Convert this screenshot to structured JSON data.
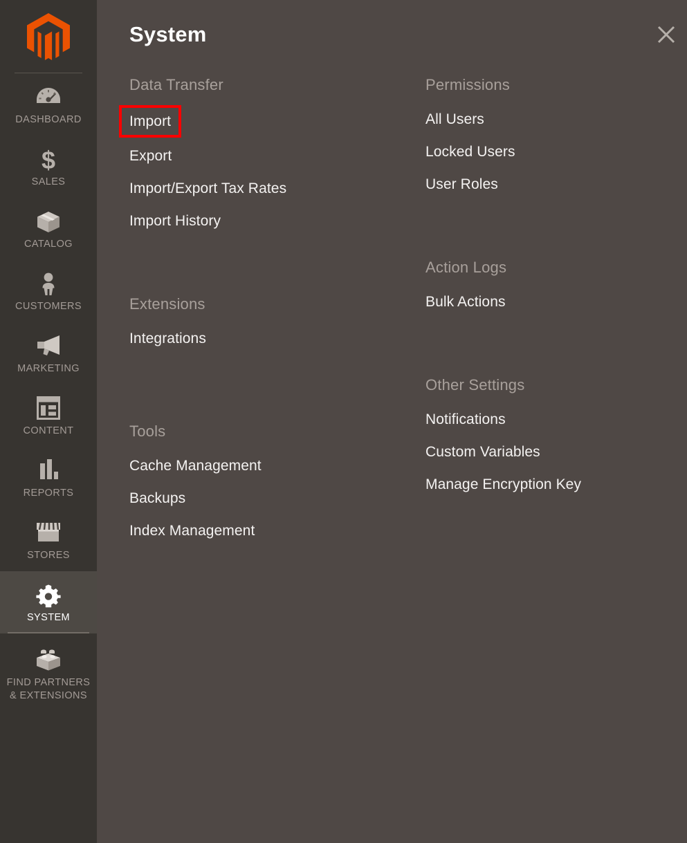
{
  "sidebar": {
    "logo": "magento-logo-icon",
    "items": [
      {
        "label": "DASHBOARD",
        "icon": "gauge-icon",
        "active": false
      },
      {
        "label": "SALES",
        "icon": "dollar-icon",
        "active": false
      },
      {
        "label": "CATALOG",
        "icon": "box-icon",
        "active": false
      },
      {
        "label": "CUSTOMERS",
        "icon": "person-icon",
        "active": false
      },
      {
        "label": "MARKETING",
        "icon": "megaphone-icon",
        "active": false
      },
      {
        "label": "CONTENT",
        "icon": "layout-icon",
        "active": false
      },
      {
        "label": "REPORTS",
        "icon": "bar-chart-icon",
        "active": false
      },
      {
        "label": "STORES",
        "icon": "storefront-icon",
        "active": false
      },
      {
        "label": "SYSTEM",
        "icon": "gear-icon",
        "active": true
      },
      {
        "label": "FIND PARTNERS & EXTENSIONS",
        "label_line1": "FIND PARTNERS",
        "label_line2": "& EXTENSIONS",
        "icon": "brick-icon",
        "active": false
      }
    ]
  },
  "panel": {
    "title": "System",
    "close_label": "close-icon"
  },
  "menu": {
    "left_column": [
      {
        "title": "Data Transfer",
        "links": [
          {
            "label": "Import",
            "highlighted": true
          },
          {
            "label": "Export",
            "highlighted": false
          },
          {
            "label": "Import/Export Tax Rates",
            "highlighted": false
          },
          {
            "label": "Import History",
            "highlighted": false
          }
        ]
      },
      {
        "title": "Extensions",
        "links": [
          {
            "label": "Integrations",
            "highlighted": false
          }
        ]
      },
      {
        "title": "Tools",
        "links": [
          {
            "label": "Cache Management",
            "highlighted": false
          },
          {
            "label": "Backups",
            "highlighted": false
          },
          {
            "label": "Index Management",
            "highlighted": false
          }
        ]
      }
    ],
    "right_column": [
      {
        "title": "Permissions",
        "links": [
          {
            "label": "All Users",
            "highlighted": false
          },
          {
            "label": "Locked Users",
            "highlighted": false
          },
          {
            "label": "User Roles",
            "highlighted": false
          }
        ]
      },
      {
        "title": "Action Logs",
        "links": [
          {
            "label": "Bulk Actions",
            "highlighted": false
          }
        ]
      },
      {
        "title": "Other Settings",
        "links": [
          {
            "label": "Notifications",
            "highlighted": false
          },
          {
            "label": "Custom Variables",
            "highlighted": false
          },
          {
            "label": "Manage Encryption Key",
            "highlighted": false
          }
        ]
      }
    ]
  },
  "colors": {
    "sidebar_bg": "#373430",
    "panel_bg": "#4f4845",
    "active_nav_bg": "#4d4944",
    "brand_orange": "#eb5202",
    "link_text": "#f4f2f1",
    "group_title_text": "#a8a09b",
    "nav_label_text": "#a39b96",
    "highlight_border": "#fb0000"
  }
}
